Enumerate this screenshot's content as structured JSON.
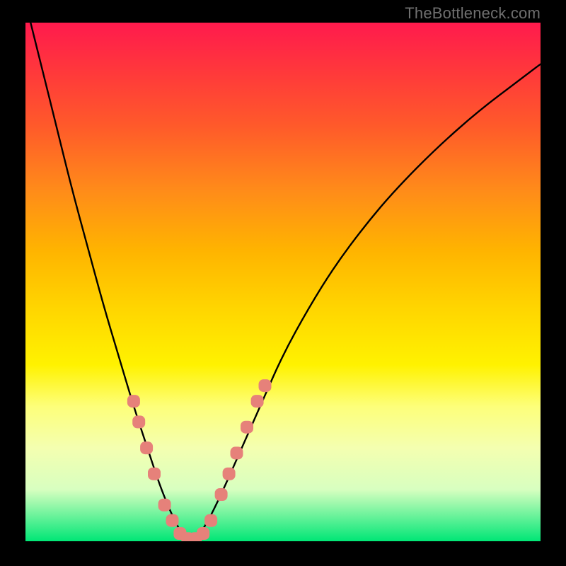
{
  "watermark": "TheBottleneck.com",
  "chart_data": {
    "type": "line",
    "title": "",
    "xlabel": "",
    "ylabel": "",
    "xlim": [
      0,
      100
    ],
    "ylim": [
      0,
      100
    ],
    "series": [
      {
        "name": "bottleneck-curve",
        "x": [
          0,
          3,
          6,
          9,
          12,
          15,
          18,
          21,
          24,
          26,
          28,
          30,
          31,
          32,
          33,
          35,
          38,
          42,
          46,
          50,
          55,
          60,
          66,
          72,
          80,
          88,
          96,
          100
        ],
        "y": [
          104,
          92,
          80,
          68,
          57,
          46,
          36,
          26,
          17,
          11,
          6,
          2,
          0.5,
          0,
          0.5,
          3,
          9,
          18,
          27,
          36,
          45,
          53,
          61,
          68,
          76,
          83,
          89,
          92
        ]
      }
    ],
    "markers": {
      "name": "highlighted-points",
      "color": "#e6817a",
      "points": [
        {
          "x": 21,
          "y": 27
        },
        {
          "x": 22,
          "y": 23
        },
        {
          "x": 23.5,
          "y": 18
        },
        {
          "x": 25,
          "y": 13
        },
        {
          "x": 27,
          "y": 7
        },
        {
          "x": 28.5,
          "y": 4
        },
        {
          "x": 30,
          "y": 1.5
        },
        {
          "x": 31.5,
          "y": 0.5
        },
        {
          "x": 33,
          "y": 0.5
        },
        {
          "x": 34.5,
          "y": 1.5
        },
        {
          "x": 36,
          "y": 4
        },
        {
          "x": 38,
          "y": 9
        },
        {
          "x": 39.5,
          "y": 13
        },
        {
          "x": 41,
          "y": 17
        },
        {
          "x": 43,
          "y": 22
        },
        {
          "x": 45,
          "y": 27
        },
        {
          "x": 46.5,
          "y": 30
        }
      ]
    },
    "gradient_stops": [
      {
        "pos": 0,
        "color": "#ff1a4d"
      },
      {
        "pos": 50,
        "color": "#ffe600"
      },
      {
        "pos": 100,
        "color": "#00e676"
      }
    ]
  }
}
